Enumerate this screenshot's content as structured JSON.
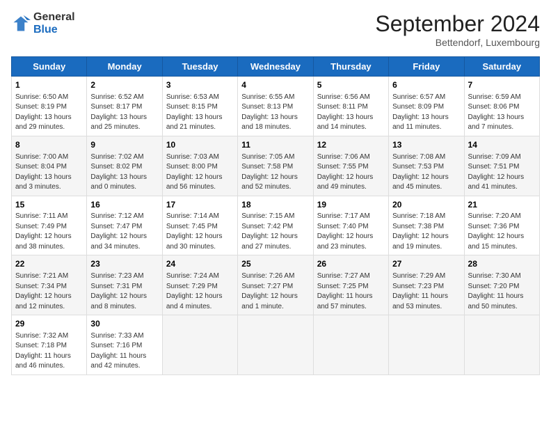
{
  "header": {
    "logo_general": "General",
    "logo_blue": "Blue",
    "month_year": "September 2024",
    "location": "Bettendorf, Luxembourg"
  },
  "days_of_week": [
    "Sunday",
    "Monday",
    "Tuesday",
    "Wednesday",
    "Thursday",
    "Friday",
    "Saturday"
  ],
  "weeks": [
    [
      {
        "day": "1",
        "info": "Sunrise: 6:50 AM\nSunset: 8:19 PM\nDaylight: 13 hours\nand 29 minutes."
      },
      {
        "day": "2",
        "info": "Sunrise: 6:52 AM\nSunset: 8:17 PM\nDaylight: 13 hours\nand 25 minutes."
      },
      {
        "day": "3",
        "info": "Sunrise: 6:53 AM\nSunset: 8:15 PM\nDaylight: 13 hours\nand 21 minutes."
      },
      {
        "day": "4",
        "info": "Sunrise: 6:55 AM\nSunset: 8:13 PM\nDaylight: 13 hours\nand 18 minutes."
      },
      {
        "day": "5",
        "info": "Sunrise: 6:56 AM\nSunset: 8:11 PM\nDaylight: 13 hours\nand 14 minutes."
      },
      {
        "day": "6",
        "info": "Sunrise: 6:57 AM\nSunset: 8:09 PM\nDaylight: 13 hours\nand 11 minutes."
      },
      {
        "day": "7",
        "info": "Sunrise: 6:59 AM\nSunset: 8:06 PM\nDaylight: 13 hours\nand 7 minutes."
      }
    ],
    [
      {
        "day": "8",
        "info": "Sunrise: 7:00 AM\nSunset: 8:04 PM\nDaylight: 13 hours\nand 3 minutes."
      },
      {
        "day": "9",
        "info": "Sunrise: 7:02 AM\nSunset: 8:02 PM\nDaylight: 13 hours\nand 0 minutes."
      },
      {
        "day": "10",
        "info": "Sunrise: 7:03 AM\nSunset: 8:00 PM\nDaylight: 12 hours\nand 56 minutes."
      },
      {
        "day": "11",
        "info": "Sunrise: 7:05 AM\nSunset: 7:58 PM\nDaylight: 12 hours\nand 52 minutes."
      },
      {
        "day": "12",
        "info": "Sunrise: 7:06 AM\nSunset: 7:55 PM\nDaylight: 12 hours\nand 49 minutes."
      },
      {
        "day": "13",
        "info": "Sunrise: 7:08 AM\nSunset: 7:53 PM\nDaylight: 12 hours\nand 45 minutes."
      },
      {
        "day": "14",
        "info": "Sunrise: 7:09 AM\nSunset: 7:51 PM\nDaylight: 12 hours\nand 41 minutes."
      }
    ],
    [
      {
        "day": "15",
        "info": "Sunrise: 7:11 AM\nSunset: 7:49 PM\nDaylight: 12 hours\nand 38 minutes."
      },
      {
        "day": "16",
        "info": "Sunrise: 7:12 AM\nSunset: 7:47 PM\nDaylight: 12 hours\nand 34 minutes."
      },
      {
        "day": "17",
        "info": "Sunrise: 7:14 AM\nSunset: 7:45 PM\nDaylight: 12 hours\nand 30 minutes."
      },
      {
        "day": "18",
        "info": "Sunrise: 7:15 AM\nSunset: 7:42 PM\nDaylight: 12 hours\nand 27 minutes."
      },
      {
        "day": "19",
        "info": "Sunrise: 7:17 AM\nSunset: 7:40 PM\nDaylight: 12 hours\nand 23 minutes."
      },
      {
        "day": "20",
        "info": "Sunrise: 7:18 AM\nSunset: 7:38 PM\nDaylight: 12 hours\nand 19 minutes."
      },
      {
        "day": "21",
        "info": "Sunrise: 7:20 AM\nSunset: 7:36 PM\nDaylight: 12 hours\nand 15 minutes."
      }
    ],
    [
      {
        "day": "22",
        "info": "Sunrise: 7:21 AM\nSunset: 7:34 PM\nDaylight: 12 hours\nand 12 minutes."
      },
      {
        "day": "23",
        "info": "Sunrise: 7:23 AM\nSunset: 7:31 PM\nDaylight: 12 hours\nand 8 minutes."
      },
      {
        "day": "24",
        "info": "Sunrise: 7:24 AM\nSunset: 7:29 PM\nDaylight: 12 hours\nand 4 minutes."
      },
      {
        "day": "25",
        "info": "Sunrise: 7:26 AM\nSunset: 7:27 PM\nDaylight: 12 hours\nand 1 minute."
      },
      {
        "day": "26",
        "info": "Sunrise: 7:27 AM\nSunset: 7:25 PM\nDaylight: 11 hours\nand 57 minutes."
      },
      {
        "day": "27",
        "info": "Sunrise: 7:29 AM\nSunset: 7:23 PM\nDaylight: 11 hours\nand 53 minutes."
      },
      {
        "day": "28",
        "info": "Sunrise: 7:30 AM\nSunset: 7:20 PM\nDaylight: 11 hours\nand 50 minutes."
      }
    ],
    [
      {
        "day": "29",
        "info": "Sunrise: 7:32 AM\nSunset: 7:18 PM\nDaylight: 11 hours\nand 46 minutes."
      },
      {
        "day": "30",
        "info": "Sunrise: 7:33 AM\nSunset: 7:16 PM\nDaylight: 11 hours\nand 42 minutes."
      },
      {
        "day": "",
        "info": ""
      },
      {
        "day": "",
        "info": ""
      },
      {
        "day": "",
        "info": ""
      },
      {
        "day": "",
        "info": ""
      },
      {
        "day": "",
        "info": ""
      }
    ]
  ]
}
